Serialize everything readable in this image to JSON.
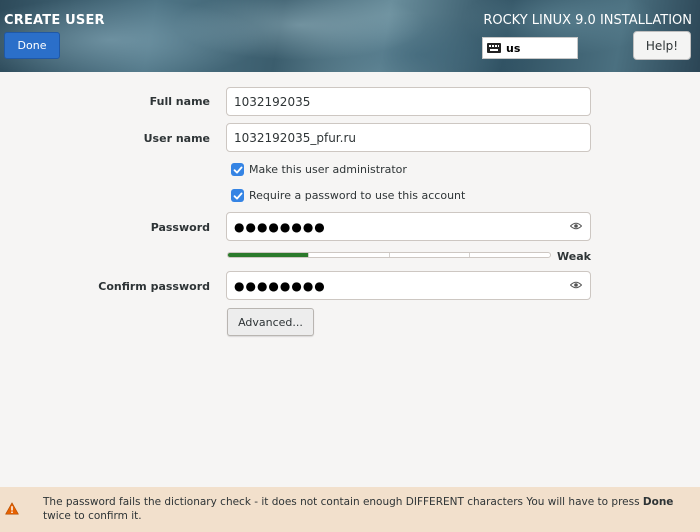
{
  "header": {
    "title": "CREATE USER",
    "install_title": "ROCKY LINUX 9.0 INSTALLATION",
    "done_label": "Done",
    "keyboard_layout": "us",
    "help_label": "Help!"
  },
  "form": {
    "full_name_label": "Full name",
    "full_name_value": "1032192035",
    "user_name_label": "User name",
    "user_name_value": "1032192035_pfur.ru",
    "admin_checkbox_label": "Make this user administrator",
    "admin_checked": true,
    "require_password_label": "Require a password to use this account",
    "require_password_checked": true,
    "password_label": "Password",
    "password_masked": "●●●●●●●●",
    "strength_label": "Weak",
    "strength_level": 0.25,
    "confirm_password_label": "Confirm password",
    "confirm_password_masked": "●●●●●●●●",
    "advanced_label": "Advanced..."
  },
  "warning": {
    "text_before": "The password fails the dictionary check - it does not contain enough DIFFERENT characters You will have to press ",
    "bold_word": "Done",
    "text_after": " twice to confirm it.",
    "color": "#f2e0cc"
  },
  "colors": {
    "accent": "#2b6fc9",
    "checkbox": "#3584e4",
    "strength_fill": "#2b7a2b",
    "warning_icon": "#e66100"
  },
  "icons": {
    "keyboard": "keyboard-icon",
    "reveal_password": "eye-icon",
    "warning": "warning-triangle-icon",
    "check": "checkmark-icon"
  }
}
